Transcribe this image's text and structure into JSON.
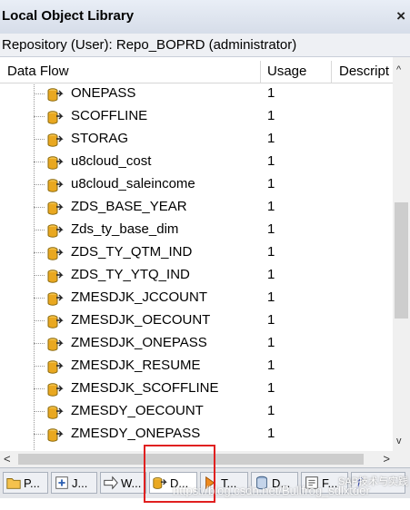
{
  "window": {
    "title": "Local Object Library",
    "close_glyph": "×"
  },
  "repository": {
    "label": "Repository (User): Repo_BOPRD (administrator)"
  },
  "columns": {
    "name": "Data Flow",
    "usage": "Usage",
    "description": "Descript"
  },
  "rows": [
    {
      "name": "ONEPASS",
      "usage": "1"
    },
    {
      "name": "SCOFFLINE",
      "usage": "1"
    },
    {
      "name": "STORAG",
      "usage": "1"
    },
    {
      "name": "u8cloud_cost",
      "usage": "1"
    },
    {
      "name": "u8cloud_saleincome",
      "usage": "1"
    },
    {
      "name": "ZDS_BASE_YEAR",
      "usage": "1"
    },
    {
      "name": "Zds_ty_base_dim",
      "usage": "1"
    },
    {
      "name": "ZDS_TY_QTM_IND",
      "usage": "1"
    },
    {
      "name": "ZDS_TY_YTQ_IND",
      "usage": "1"
    },
    {
      "name": "ZMESDJK_JCCOUNT",
      "usage": "1"
    },
    {
      "name": "ZMESDJK_OECOUNT",
      "usage": "1"
    },
    {
      "name": "ZMESDJK_ONEPASS",
      "usage": "1"
    },
    {
      "name": "ZMESDJK_RESUME",
      "usage": "1"
    },
    {
      "name": "ZMESDJK_SCOFFLINE",
      "usage": "1"
    },
    {
      "name": "ZMESDY_OECOUNT",
      "usage": "1"
    },
    {
      "name": "ZMESDY_ONEPASS",
      "usage": "1"
    }
  ],
  "row_icon": "dataflow-icon",
  "scroll": {
    "up": "^",
    "down": "v",
    "left": "<",
    "right": ">"
  },
  "tabs": [
    {
      "label": "P...",
      "icon": "project-icon"
    },
    {
      "label": "J...",
      "icon": "job-icon"
    },
    {
      "label": "W...",
      "icon": "workflow-icon"
    },
    {
      "label": "D...",
      "icon": "dataflow-icon",
      "active": true
    },
    {
      "label": "T...",
      "icon": "transform-icon"
    },
    {
      "label": "D...",
      "icon": "datastore-icon"
    },
    {
      "label": "F...",
      "icon": "format-icon"
    },
    {
      "label": "",
      "icon": "function-icon"
    }
  ],
  "watermark": "https://blog.csdn.net/Bullfrog_sdlxtder",
  "watermark2": "SAP技术与实践",
  "colors": {
    "highlight": "#e02020",
    "accent": "#f0a020"
  }
}
